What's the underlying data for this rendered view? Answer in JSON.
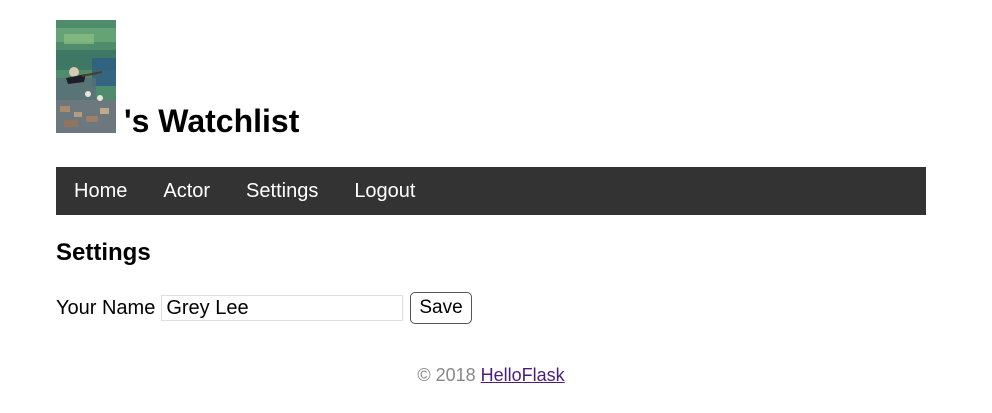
{
  "header": {
    "avatar_alt": "avatar",
    "title": "'s Watchlist"
  },
  "nav": {
    "items": [
      {
        "label": "Home"
      },
      {
        "label": "Actor"
      },
      {
        "label": "Settings"
      },
      {
        "label": "Logout"
      }
    ]
  },
  "main": {
    "section_title": "Settings",
    "form": {
      "name_label": "Your Name",
      "name_value": "Grey Lee",
      "save_label": "Save"
    }
  },
  "footer": {
    "copyright": "© 2018",
    "link_text": "HelloFlask"
  },
  "colors": {
    "navbar_bg": "#333333",
    "nav_text": "#ffffff",
    "footer_text": "#888888",
    "footer_link": "#4b1d78"
  }
}
